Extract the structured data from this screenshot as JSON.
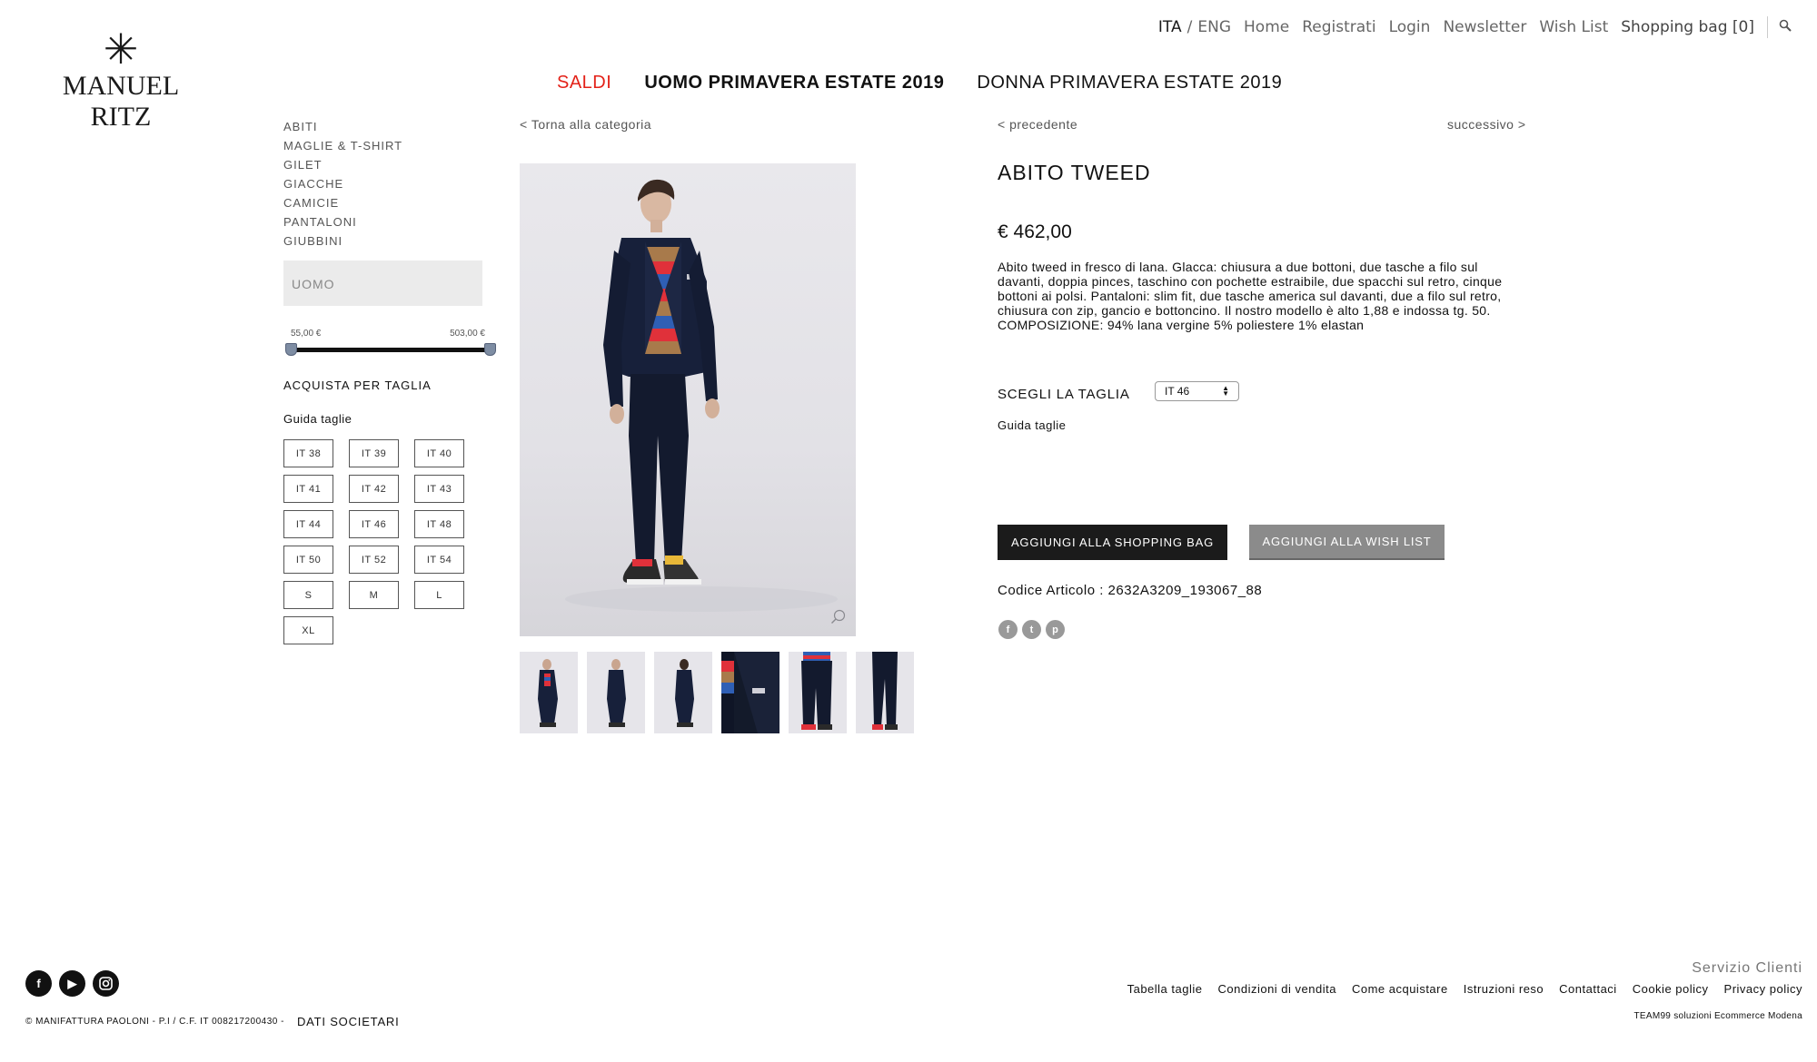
{
  "brand": {
    "name": "MANUEL RITZ",
    "star": "✳"
  },
  "topnav": {
    "lang_active": "ITA",
    "lang_sep": "/",
    "lang_other": "ENG",
    "home": "Home",
    "register": "Registrati",
    "login": "Login",
    "newsletter": "Newsletter",
    "wishlist": "Wish List",
    "bag": "Shopping bag [0]",
    "search_icon": "search-icon"
  },
  "mainnav": {
    "sale": "SALDI",
    "men": "UOMO PRIMAVERA ESTATE 2019",
    "women": "DONNA PRIMAVERA ESTATE 2019",
    "sale_color": "#e32219"
  },
  "sidebar": {
    "categories": [
      "ABITI",
      "MAGLIE & T-SHIRT",
      "GILET",
      "GIACCHE",
      "CAMICIE",
      "PANTALONI",
      "GIUBBINI"
    ],
    "filter_value": "UOMO",
    "price_min": "55,00 €",
    "price_max": "503,00 €",
    "shop_by_size": "ACQUISTA PER TAGLIA",
    "size_guide": "Guida taglie",
    "sizes": [
      "IT 38",
      "IT 39",
      "IT 40",
      "IT 41",
      "IT 42",
      "IT 43",
      "IT 44",
      "IT 46",
      "IT 48",
      "IT 50",
      "IT 52",
      "IT 54",
      "S",
      "M",
      "L",
      "XL"
    ]
  },
  "gallery": {
    "back": "< Torna alla categoria",
    "zoom_icon": "zoom-icon",
    "thumb_count": 6
  },
  "product": {
    "prev": "< precedente",
    "next": "successivo >",
    "title": "ABITO TWEED",
    "price": "€ 462,00",
    "description": "Abito tweed in fresco di lana. Glacca: chiusura a due bottoni, due tasche a filo sul davanti, doppia pinces, taschino con pochette estraibile, due spacchi sul retro, cinque bottoni ai polsi. Pantaloni: slim fit, due tasche america sul davanti, due a filo sul retro, chiusura con zip, gancio e bottoncino. Il nostro modello è alto 1,88 e indossa tg. 50. COMPOSIZIONE: 94% lana vergine 5% poliestere 1% elastan",
    "choose_size": "SCEGLI LA TAGLIA",
    "selected_size": "IT 46",
    "size_guide": "Guida taglie",
    "add_to_bag": "AGGIUNGI ALLA SHOPPING BAG",
    "add_to_wish": "AGGIUNGI ALLA WISH LIST",
    "sku": "Codice Articolo : 2632A3209_193067_88",
    "share_icons": [
      "facebook-icon",
      "twitter-icon",
      "pinterest-icon"
    ]
  },
  "footer": {
    "social_icons": [
      "facebook-icon",
      "youtube-icon",
      "instagram-icon"
    ],
    "copyright": "© MANIFATTURA PAOLONI - P.I / C.F. IT 008217200430 -",
    "company_data": "DATI SOCIETARI",
    "service_title": "Servizio Clienti",
    "links": [
      "Tabella taglie",
      "Condizioni di vendita",
      "Come acquistare",
      "Istruzioni reso",
      "Contattaci",
      "Cookie policy",
      "Privacy policy"
    ],
    "credits": "TEAM99 soluzioni Ecommerce Modena"
  }
}
